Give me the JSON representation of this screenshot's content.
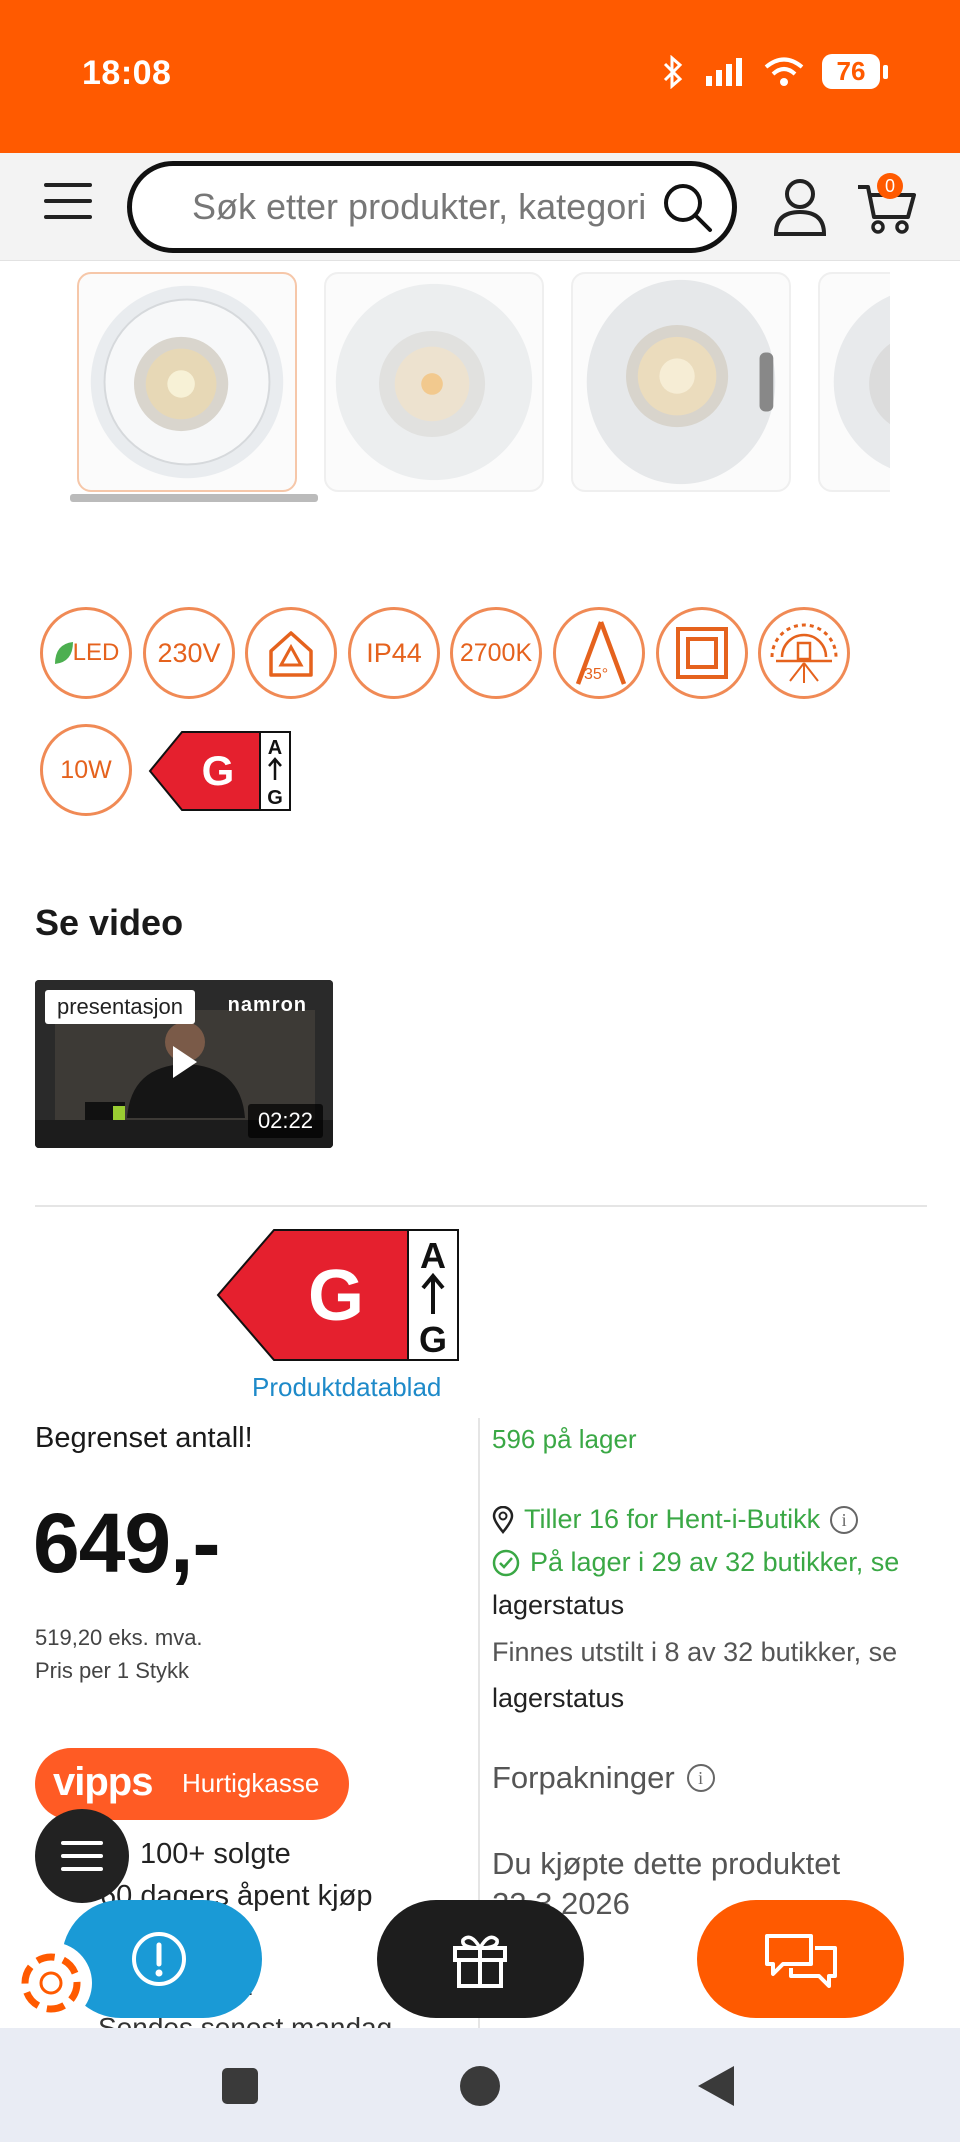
{
  "status": {
    "time": "18:08",
    "battery": "76"
  },
  "header": {
    "search_placeholder": "Søk etter produkter, kategorier",
    "cart_count": "0"
  },
  "features": {
    "icons": [
      "LED",
      "230V",
      "house-icon",
      "IP44",
      "2700K",
      "beam-angle-icon",
      "double-insulation-icon",
      "dimmable-icon",
      "10W"
    ],
    "labels": {
      "led": "LED",
      "v": "230V",
      "ip": "IP44",
      "k": "2700K",
      "angle": "35°",
      "w": "10W"
    },
    "energy_class": "G",
    "energy_scale_top": "A",
    "energy_scale_bottom": "G"
  },
  "video": {
    "section_title": "Se video",
    "tag": "presentasjon",
    "brand": "namron",
    "duration": "02:22"
  },
  "energy_label": {
    "class": "G",
    "scale_top": "A",
    "scale_bottom": "G",
    "datasheet_link": "Produktdatablad"
  },
  "pricing": {
    "limited": "Begrenset antall!",
    "price": "649,-",
    "ex_vat": "519,20 eks. mva.",
    "per_unit": "Pris per 1 Stykk",
    "vipps_logo": "vipps",
    "vipps_label": "Hurtigkasse",
    "sold": "100+ solgte",
    "open_purchase": "60 dagers åpent kjøp",
    "dash_line": "–",
    "shipping": "Sendes senest mandag"
  },
  "availability": {
    "stock": "596 på lager",
    "store": "Tiller 16 for Hent-i-Butikk",
    "in_stores": "På lager i 29 av 32 butikker, se",
    "in_stores_link": "lagerstatus",
    "exhibited": "Finnes utstilt i 8 av 32 butikker, se",
    "exhibited_link": "lagerstatus",
    "packing": "Forpakninger",
    "bought_label": "Du kjøpte dette produktet",
    "bought_date": "22.3.2026"
  },
  "colors": {
    "brand": "#ff5a00",
    "green": "#3aa845",
    "link": "#1e8ac9",
    "feedback": "#1a9ad6"
  }
}
